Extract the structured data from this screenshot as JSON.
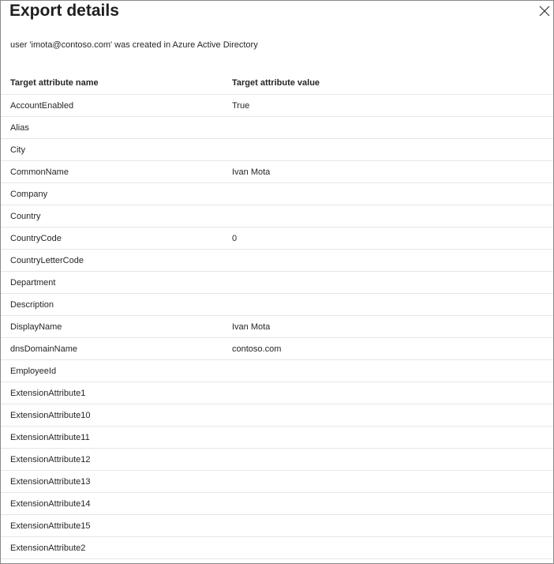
{
  "panel": {
    "title": "Export details",
    "message": "user 'imota@contoso.com' was created in Azure Active Directory"
  },
  "table": {
    "headers": [
      "Target attribute name",
      "Target attribute value"
    ],
    "rows": [
      [
        "AccountEnabled",
        "True"
      ],
      [
        "Alias",
        ""
      ],
      [
        "City",
        ""
      ],
      [
        "CommonName",
        "Ivan Mota"
      ],
      [
        "Company",
        ""
      ],
      [
        "Country",
        ""
      ],
      [
        "CountryCode",
        "0"
      ],
      [
        "CountryLetterCode",
        ""
      ],
      [
        "Department",
        ""
      ],
      [
        "Description",
        ""
      ],
      [
        "DisplayName",
        "Ivan Mota"
      ],
      [
        "dnsDomainName",
        "contoso.com"
      ],
      [
        "EmployeeId",
        ""
      ],
      [
        "ExtensionAttribute1",
        ""
      ],
      [
        "ExtensionAttribute10",
        ""
      ],
      [
        "ExtensionAttribute11",
        ""
      ],
      [
        "ExtensionAttribute12",
        ""
      ],
      [
        "ExtensionAttribute13",
        ""
      ],
      [
        "ExtensionAttribute14",
        ""
      ],
      [
        "ExtensionAttribute15",
        ""
      ],
      [
        "ExtensionAttribute2",
        ""
      ]
    ]
  },
  "icons": {
    "close": "close-icon"
  }
}
